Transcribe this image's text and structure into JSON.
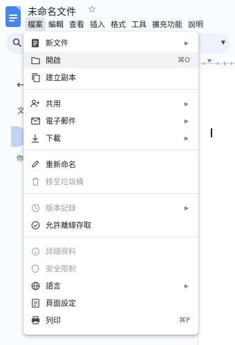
{
  "header": {
    "doc_title": "未命名文件",
    "menus": [
      "檔案",
      "編輯",
      "查看",
      "插入",
      "格式",
      "工具",
      "擴充功能",
      "說明"
    ]
  },
  "outline": {
    "heading_char": "文",
    "note_char": "你"
  },
  "file_menu": {
    "new_document": "新文件",
    "open": "開啟",
    "open_shortcut": "⌘O",
    "make_copy": "建立副本",
    "share": "共用",
    "email": "電子郵件",
    "download": "下載",
    "rename": "重新命名",
    "move_to_trash": "移至垃圾桶",
    "version_history": "版本記錄",
    "make_available_offline": "允許離線存取",
    "details": "詳細資料",
    "security_limitations": "安全限制",
    "language": "語言",
    "page_setup": "頁面設定",
    "print": "列印",
    "print_shortcut": "⌘P"
  },
  "colors": {
    "accent": "#4285f4",
    "menu_highlight": "#f1f3f4",
    "disabled_text": "#9aa0a6"
  }
}
